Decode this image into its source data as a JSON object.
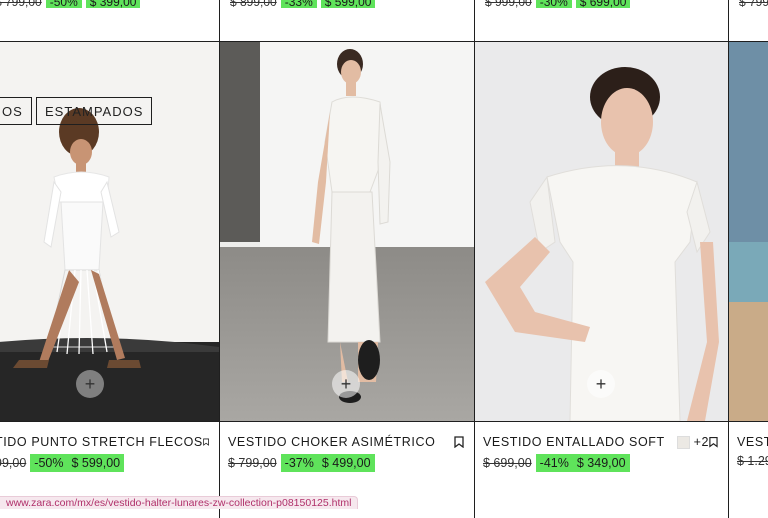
{
  "products": [
    {
      "top_old": "$ 799,00",
      "top_disc": "-50%",
      "top_new": "$ 399,00",
      "name": "TIDO PUNTO STRETCH FLECOS",
      "old_price": "99,00",
      "discount": "-50%",
      "price": "$ 599,00",
      "tags": [
        "OS",
        "ESTAMPADOS"
      ]
    },
    {
      "top_old": "$ 899,00",
      "top_disc": "-33%",
      "top_new": "$ 599,00",
      "name": "VESTIDO CHOKER ASIMÉTRICO",
      "old_price": "$ 799,00",
      "discount": "-37%",
      "price": "$ 499,00"
    },
    {
      "top_old": "$ 999,00",
      "top_disc": "-30%",
      "top_new": "$ 699,00",
      "name": "VESTIDO ENTALLADO SOFT",
      "color_more": "+2",
      "old_price": "$ 699,00",
      "discount": "-41%",
      "price": "$ 349,00"
    },
    {
      "top_old": "$ 799",
      "name": "VEST",
      "old_price": "$ 1.29"
    }
  ],
  "status_url": "www.zara.com/mx/es/vestido-halter-lunares-zw-collection-p08150125.html",
  "colors": {
    "discount_bg": "#5fe35b",
    "border": "#1f1f1f",
    "status_text": "#b0306a"
  },
  "icons": [
    "plus-icon",
    "bookmark-icon"
  ]
}
